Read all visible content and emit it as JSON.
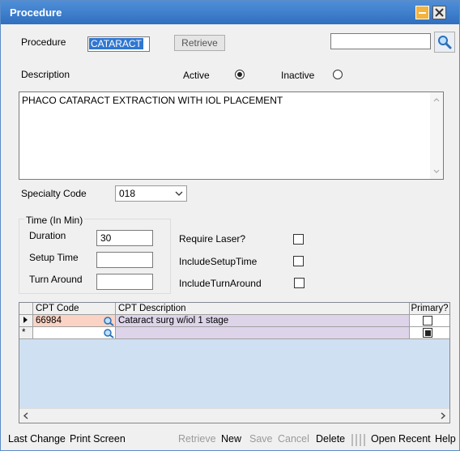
{
  "window": {
    "title": "Procedure"
  },
  "procedure": {
    "label": "Procedure",
    "value": "CATARACT",
    "retrieve_label": "Retrieve",
    "search_value": ""
  },
  "description": {
    "label": "Description",
    "active_label": "Active",
    "inactive_label": "Inactive",
    "active_selected": true,
    "text": "PHACO CATARACT EXTRACTION WITH IOL PLACEMENT"
  },
  "specialty": {
    "label": "Specialty Code",
    "value": "018"
  },
  "time": {
    "group_label": "Time (In Min)",
    "duration_label": "Duration",
    "duration_value": "30",
    "setup_label": "Setup Time",
    "setup_value": "",
    "turn_label": "Turn Around",
    "turn_value": ""
  },
  "options": {
    "require_laser_label": "Require Laser?",
    "include_setup_label": "IncludeSetupTime",
    "include_turn_label": "IncludeTurnAround"
  },
  "grid": {
    "headers": {
      "cpt_code": "CPT Code",
      "cpt_desc": "CPT Description",
      "primary": "Primary?"
    },
    "rows": [
      {
        "cpt_code": "66984",
        "cpt_desc": "Cataract surg w/iol 1 stage",
        "primary": false
      },
      {
        "cpt_code": "",
        "cpt_desc": "",
        "primary": true
      }
    ],
    "new_row_marker": "*"
  },
  "footer": {
    "last_change": "Last Change",
    "print_screen": "Print Screen",
    "retrieve": "Retrieve",
    "new": "New",
    "save": "Save",
    "cancel": "Cancel",
    "delete": "Delete",
    "open_recent": "Open Recent",
    "help": "Help"
  },
  "colors": {
    "title_bar": "#3a7bcf",
    "grid_bg": "#cfe0f2",
    "row_highlight": "#fbd3c4",
    "row_purple": "#ddd4ea"
  }
}
